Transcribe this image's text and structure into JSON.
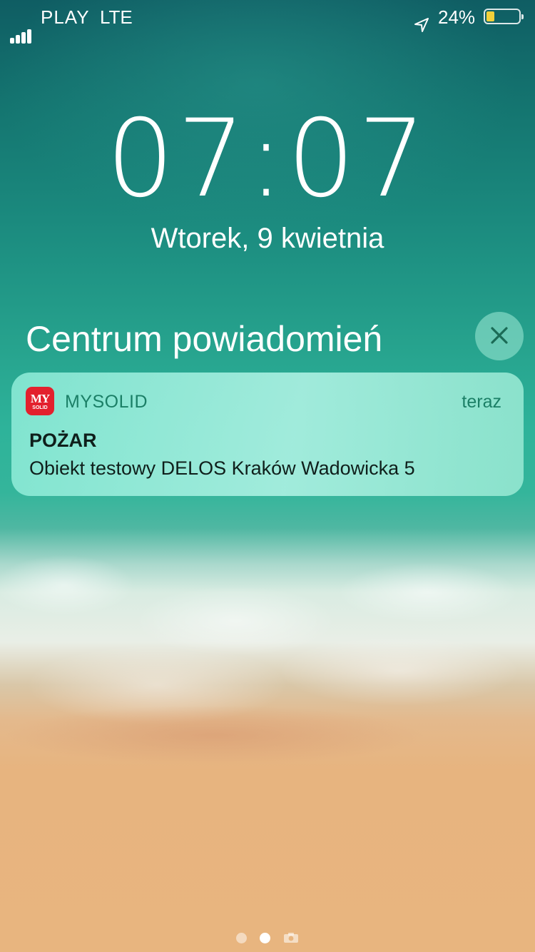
{
  "status_bar": {
    "carrier": "PLAY",
    "network": "LTE",
    "battery_percent": "24%",
    "battery_level": 0.24,
    "signal_bars": 4,
    "location_icon": "location-arrow-icon",
    "battery_color": "#f3d13a"
  },
  "lock_screen": {
    "time": "07:07",
    "date": "Wtorek, 9 kwietnia"
  },
  "notification_center": {
    "title": "Centrum powiadomień",
    "close_icon": "close-icon"
  },
  "notification": {
    "app_name": "MYSOLID",
    "app_icon_line1": "MY",
    "app_icon_line2": "SOLID",
    "time": "teraz",
    "title": "POŻAR",
    "body": "Obiekt testowy DELOS Kraków Wadowicka 5",
    "accent_color": "#1b7f66",
    "icon_color": "#e3202d"
  },
  "page_indicator": {
    "pages": 2,
    "active_page": 2,
    "camera_icon": "camera-icon"
  }
}
